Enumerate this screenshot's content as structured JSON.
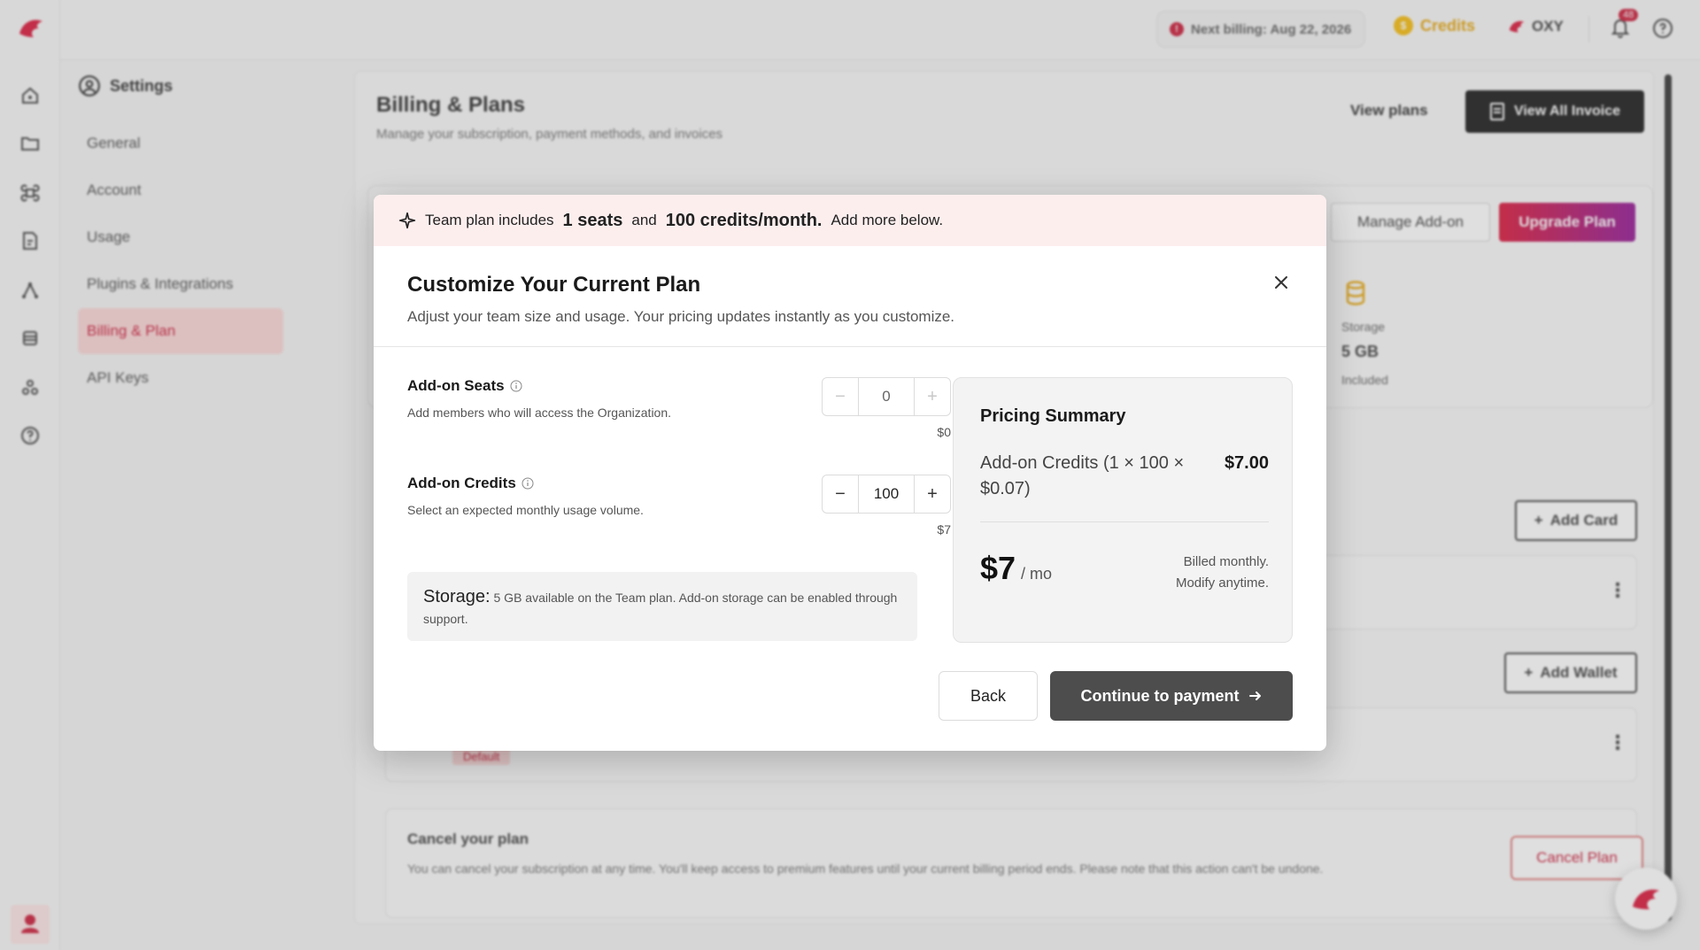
{
  "topbar": {
    "billing_info": "Next billing: Aug 22, 2026",
    "credits_label": "Credits",
    "org_name": "OXY",
    "notification_count": "48"
  },
  "settings": {
    "title": "Settings",
    "nav": [
      {
        "label": "General"
      },
      {
        "label": "Account"
      },
      {
        "label": "Usage"
      },
      {
        "label": "Plugins & Integrations"
      },
      {
        "label": "Billing & Plan",
        "active": true
      },
      {
        "label": "API Keys"
      }
    ]
  },
  "billing": {
    "title": "Billing & Plans",
    "subtitle": "Manage your subscription, payment methods, and invoices",
    "view_plans": "View plans",
    "view_invoice": "View All Invoice",
    "manage_addon": "Manage Add-on",
    "upgrade_plan": "Upgrade Plan",
    "storage_label": "Storage",
    "storage_value": "5 GB",
    "storage_included": "Included",
    "add_card": "Add Card",
    "add_wallet": "Add Wallet",
    "default_tag": "Default",
    "cancel_title": "Cancel your plan",
    "cancel_text": "You can cancel your subscription at any time. You'll keep access to premium features until your current billing period ends. Please note that this action can't be undone.",
    "cancel_button": "Cancel Plan"
  },
  "modal": {
    "banner": {
      "prefix": "Team plan includes",
      "seats": "1 seats",
      "and": "and",
      "credits": "100 credits/month.",
      "suffix": "Add more below."
    },
    "title": "Customize Your Current Plan",
    "subtitle": "Adjust your team size and usage. Your pricing updates instantly as you customize.",
    "seats": {
      "title": "Add-on Seats",
      "description": "Add members who will access the Organization.",
      "value": "0",
      "price": "$0"
    },
    "credits": {
      "title": "Add-on Credits",
      "description": "Select an expected monthly usage volume.",
      "value": "100",
      "price": "$7"
    },
    "storage": {
      "label": "Storage:",
      "text": "5 GB available on the Team plan. Add-on storage can be enabled through support."
    },
    "summary": {
      "title": "Pricing Summary",
      "line_label": "Add-on Credits (1 × 100 × $0.07)",
      "line_amount": "$7.00",
      "total": "$7",
      "per": "/ mo",
      "note_1": "Billed monthly.",
      "note_2": "Modify anytime."
    },
    "back": "Back",
    "continue": "Continue to payment"
  },
  "colors": {
    "brand_red": "#c8102e",
    "banner_bg": "#fdeeee",
    "continue_bg": "#4d4d4d"
  }
}
